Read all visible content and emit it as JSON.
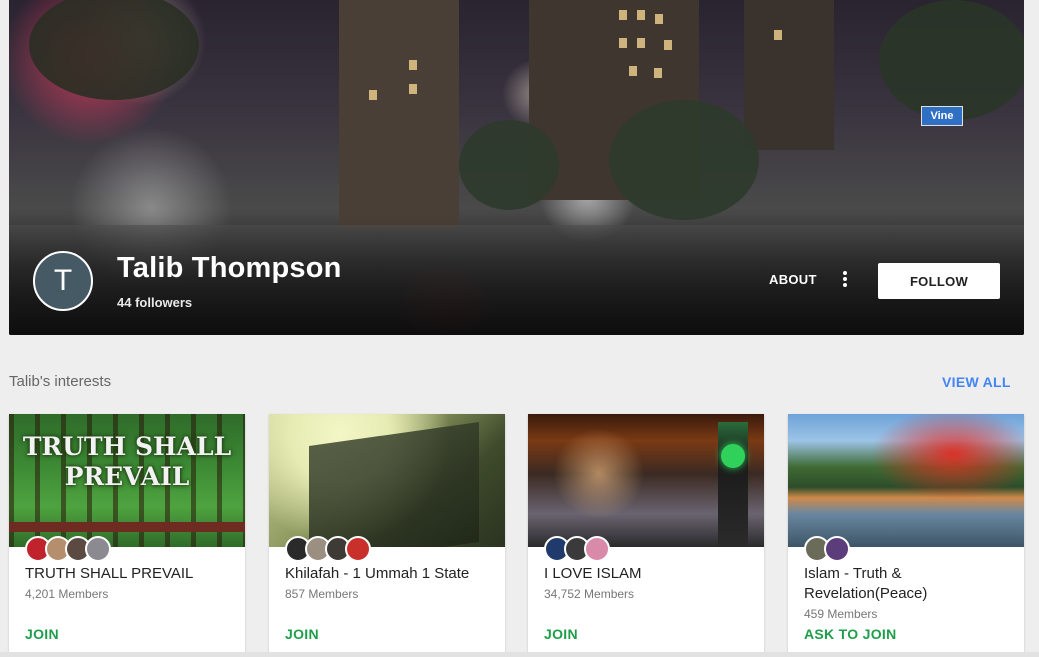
{
  "profile": {
    "avatar_letter": "T",
    "name": "Talib Thompson",
    "followers": "44 followers",
    "about_label": "ABOUT",
    "follow_label": "FOLLOW",
    "street_sign": "Vine"
  },
  "interests": {
    "title": "Talib's interests",
    "view_all": "VIEW ALL",
    "cards": [
      {
        "title": "TRUTH SHALL PREVAIL",
        "members": "4,201 Members",
        "action": "JOIN",
        "image_text": "TRUTH SHALL PREVAIL"
      },
      {
        "title": "Khilafah - 1 Ummah 1 State",
        "members": "857 Members",
        "action": "JOIN"
      },
      {
        "title": "I LOVE ISLAM",
        "members": "34,752 Members",
        "action": "JOIN"
      },
      {
        "title": "Islam - Truth & Revelation(Peace)",
        "members": "459 Members",
        "action": "ASK TO JOIN"
      }
    ]
  },
  "colors": {
    "accent_link": "#4285f4",
    "join_green": "#1e9e4a",
    "avatar_bg": "#455a64"
  }
}
